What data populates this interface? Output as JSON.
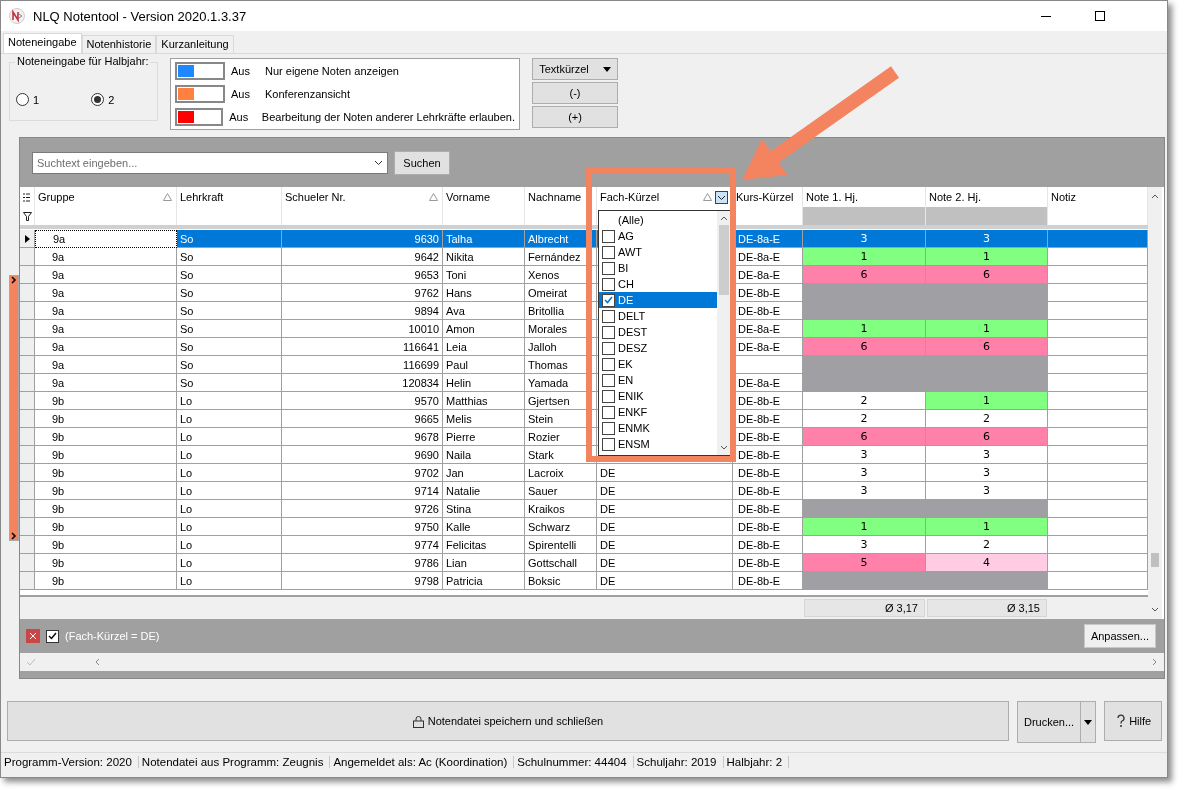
{
  "window": {
    "title": "NLQ Notentool - Version 2020.1.3.37"
  },
  "tabs": [
    {
      "label": "Noteneingabe",
      "selected": true
    },
    {
      "label": "Notenhistorie",
      "selected": false
    },
    {
      "label": "Kurzanleitung",
      "selected": false
    }
  ],
  "halbjahr": {
    "legend": "Noteneingabe für Halbjahr:",
    "options": [
      {
        "label": "1",
        "selected": false
      },
      {
        "label": "2",
        "selected": true
      }
    ]
  },
  "toggles": [
    {
      "color": "#1e88ff",
      "on": false,
      "state": "Aus",
      "label": "Nur eigene Noten anzeigen"
    },
    {
      "color": "#ff8040",
      "on": false,
      "state": "Aus",
      "label": "Konferenzansicht"
    },
    {
      "color": "#ff0000",
      "on": false,
      "state": "Aus",
      "label": "Bearbeitung der Noten anderer Lehrkräfte erlauben."
    }
  ],
  "toolbar_buttons": [
    {
      "label": "Textkürzel",
      "kind": "dropdown"
    },
    {
      "label": "(-)",
      "kind": "plain"
    },
    {
      "label": "(+)",
      "kind": "plain"
    }
  ],
  "search": {
    "placeholder": "Suchtext eingeben...",
    "button": "Suchen"
  },
  "table": {
    "columns": [
      {
        "label": "Gruppe",
        "kind": "text",
        "sorted": true
      },
      {
        "label": "Lehrkraft",
        "kind": "text",
        "sorted": false
      },
      {
        "label": "Schueler Nr.",
        "kind": "number",
        "sorted": true
      },
      {
        "label": "Vorname",
        "kind": "text",
        "sorted": false
      },
      {
        "label": "Nachname",
        "kind": "text",
        "sorted": false
      },
      {
        "label": "Fach-Kürzel",
        "kind": "filtered",
        "sorted": true
      },
      {
        "label": "Kurs-Kürzel",
        "kind": "text",
        "sorted": false
      },
      {
        "label": "Note 1. Hj.",
        "kind": "grade",
        "sorted": false
      },
      {
        "label": "Note 2. Hj.",
        "kind": "grade",
        "sorted": false
      },
      {
        "label": "Notiz",
        "kind": "text",
        "sorted": false
      }
    ],
    "rows": [
      {
        "selected": true,
        "gruppe": "9a",
        "lehrkraft": "So",
        "nr": "9630",
        "vorname": "Talha",
        "nachname": "Albrecht",
        "kurs": "DE-8a-E",
        "n1": {
          "text": "3"
        },
        "n2": {
          "text": "3"
        }
      },
      {
        "selected": false,
        "gruppe": "9a",
        "lehrkraft": "So",
        "nr": "9642",
        "vorname": "Nikita",
        "nachname": "Fernández",
        "kurs": "DE-8a-E",
        "n1": {
          "text": "1",
          "color": "#80ff80"
        },
        "n2": {
          "text": "1",
          "color": "#80ff80"
        }
      },
      {
        "selected": false,
        "gruppe": "9a",
        "lehrkraft": "So",
        "nr": "9653",
        "vorname": "Toni",
        "nachname": "Xenos",
        "kurs": "DE-8a-E",
        "n1": {
          "text": "6",
          "color": "#ff80a8"
        },
        "n2": {
          "text": "6",
          "color": "#ff80a8"
        }
      },
      {
        "selected": false,
        "gruppe": "9a",
        "lehrkraft": "So",
        "nr": "9762",
        "vorname": "Hans",
        "nachname": "Omeirat",
        "kurs": "DE-8b-E",
        "n1": {
          "color": "#a0a0a4"
        },
        "n2": {
          "color": "#a0a0a4"
        }
      },
      {
        "selected": false,
        "gruppe": "9a",
        "lehrkraft": "So",
        "nr": "9894",
        "vorname": "Ava",
        "nachname": "Britollia",
        "kurs": "DE-8b-E",
        "n1": {
          "color": "#a0a0a4"
        },
        "n2": {
          "color": "#a0a0a4"
        }
      },
      {
        "selected": false,
        "gruppe": "9a",
        "lehrkraft": "So",
        "nr": "10010",
        "vorname": "Amon",
        "nachname": "Morales",
        "kurs": "DE-8a-E",
        "n1": {
          "text": "1",
          "color": "#80ff80"
        },
        "n2": {
          "text": "1",
          "color": "#80ff80"
        }
      },
      {
        "selected": false,
        "gruppe": "9a",
        "lehrkraft": "So",
        "nr": "116641",
        "vorname": "Leia",
        "nachname": "Jalloh",
        "kurs": "DE-8a-E",
        "n1": {
          "text": "6",
          "color": "#ff80a8"
        },
        "n2": {
          "text": "6",
          "color": "#ff80a8"
        }
      },
      {
        "selected": false,
        "gruppe": "9a",
        "lehrkraft": "So",
        "nr": "116699",
        "vorname": "Paul",
        "nachname": "Thomas",
        "n1": {
          "color": "#a0a0a4"
        },
        "n2": {
          "color": "#a0a0a4"
        }
      },
      {
        "selected": false,
        "gruppe": "9a",
        "lehrkraft": "So",
        "nr": "120834",
        "vorname": "Helin",
        "nachname": "Yamada",
        "kurs": "DE-8a-E",
        "n1": {
          "color": "#a0a0a4"
        },
        "n2": {
          "color": "#a0a0a4"
        }
      },
      {
        "selected": false,
        "gruppe": "9b",
        "lehrkraft": "Lo",
        "nr": "9570",
        "vorname": "Matthias",
        "nachname": "Gjertsen",
        "kurs": "DE-8b-E",
        "n1": {
          "text": "2",
          "color": "#ffffff"
        },
        "n2": {
          "text": "1",
          "color": "#80ff80"
        }
      },
      {
        "selected": false,
        "gruppe": "9b",
        "lehrkraft": "Lo",
        "nr": "9665",
        "vorname": "Melis",
        "nachname": "Stein",
        "kurs": "DE-8b-E",
        "n1": {
          "text": "2",
          "color": "#ffffff"
        },
        "n2": {
          "text": "2",
          "color": "#ffffff"
        }
      },
      {
        "selected": false,
        "gruppe": "9b",
        "lehrkraft": "Lo",
        "nr": "9678",
        "vorname": "Pierre",
        "nachname": "Rozier",
        "kurs": "DE-8b-E",
        "n1": {
          "text": "6",
          "color": "#ff80a8"
        },
        "n2": {
          "text": "6",
          "color": "#ff80a8"
        }
      },
      {
        "selected": false,
        "gruppe": "9b",
        "lehrkraft": "Lo",
        "nr": "9690",
        "vorname": "Naila",
        "nachname": "Stark",
        "kurs": "DE-8b-E",
        "n1": {
          "text": "3",
          "color": "#ffffff"
        },
        "n2": {
          "text": "3",
          "color": "#ffffff"
        }
      },
      {
        "selected": false,
        "gruppe": "9b",
        "lehrkraft": "Lo",
        "nr": "9702",
        "vorname": "Jan",
        "nachname": "Lacroix",
        "fach": "DE",
        "kurs": "DE-8b-E",
        "n1": {
          "text": "3",
          "color": "#ffffff"
        },
        "n2": {
          "text": "3",
          "color": "#ffffff"
        }
      },
      {
        "selected": false,
        "gruppe": "9b",
        "lehrkraft": "Lo",
        "nr": "9714",
        "vorname": "Natalie",
        "nachname": "Sauer",
        "fach": "DE",
        "kurs": "DE-8b-E",
        "n1": {
          "text": "3",
          "color": "#ffffff"
        },
        "n2": {
          "text": "3",
          "color": "#ffffff"
        }
      },
      {
        "selected": false,
        "gruppe": "9b",
        "lehrkraft": "Lo",
        "nr": "9726",
        "vorname": "Stina",
        "nachname": "Kraikos",
        "fach": "DE",
        "kurs": "DE-8b-E",
        "n1": {
          "color": "#a0a0a4"
        },
        "n2": {
          "color": "#a0a0a4"
        }
      },
      {
        "selected": false,
        "gruppe": "9b",
        "lehrkraft": "Lo",
        "nr": "9750",
        "vorname": "Kalle",
        "nachname": "Schwarz",
        "fach": "DE",
        "kurs": "DE-8b-E",
        "n1": {
          "text": "1",
          "color": "#80ff80"
        },
        "n2": {
          "text": "1",
          "color": "#80ff80"
        }
      },
      {
        "selected": false,
        "gruppe": "9b",
        "lehrkraft": "Lo",
        "nr": "9774",
        "vorname": "Felicitas",
        "nachname": "Spirentelli",
        "fach": "DE",
        "kurs": "DE-8b-E",
        "n1": {
          "text": "3",
          "color": "#ffffff"
        },
        "n2": {
          "text": "2",
          "color": "#ffffff"
        }
      },
      {
        "selected": false,
        "gruppe": "9b",
        "lehrkraft": "Lo",
        "nr": "9786",
        "vorname": "Lian",
        "nachname": "Gottschall",
        "fach": "DE",
        "kurs": "DE-8b-E",
        "n1": {
          "text": "5",
          "color": "#ff80a8"
        },
        "n2": {
          "text": "4",
          "color": "#ffcce4"
        }
      },
      {
        "selected": false,
        "gruppe": "9b",
        "lehrkraft": "Lo",
        "nr": "9798",
        "vorname": "Patricia",
        "nachname": "Boksic",
        "fach": "DE",
        "kurs": "DE-8b-E",
        "n1": {
          "color": "#a0a0a4"
        },
        "n2": {
          "color": "#a0a0a4"
        }
      }
    ],
    "summary": {
      "n1": "Ø 3,17",
      "n2": "Ø 3,15"
    }
  },
  "filter_dropdown": {
    "items": [
      {
        "kind": "all",
        "label": "(Alle)",
        "selected": false
      },
      {
        "kind": "value",
        "label": "AG",
        "checked": false,
        "selected": false
      },
      {
        "kind": "value",
        "label": "AWT",
        "checked": false,
        "selected": false
      },
      {
        "kind": "value",
        "label": "BI",
        "checked": false,
        "selected": false
      },
      {
        "kind": "value",
        "label": "CH",
        "checked": false,
        "selected": false
      },
      {
        "kind": "value",
        "label": "DE",
        "checked": true,
        "selected": true
      },
      {
        "kind": "value",
        "label": "DELT",
        "checked": false,
        "selected": false
      },
      {
        "kind": "value",
        "label": "DEST",
        "checked": false,
        "selected": false
      },
      {
        "kind": "value",
        "label": "DESZ",
        "checked": false,
        "selected": false
      },
      {
        "kind": "value",
        "label": "EK",
        "checked": false,
        "selected": false
      },
      {
        "kind": "value",
        "label": "EN",
        "checked": false,
        "selected": false
      },
      {
        "kind": "value",
        "label": "ENIK",
        "checked": false,
        "selected": false
      },
      {
        "kind": "value",
        "label": "ENKF",
        "checked": false,
        "selected": false
      },
      {
        "kind": "value",
        "label": "ENMK",
        "checked": false,
        "selected": false
      },
      {
        "kind": "value",
        "label": "ENSM",
        "checked": false,
        "selected": false
      }
    ]
  },
  "filter_bar": {
    "checked": true,
    "expression": "(Fach-Kürzel = DE)",
    "button": "Anpassen..."
  },
  "actions": {
    "save": "Notendatei speichern und schließen",
    "print": "Drucken...",
    "help": "Hilfe"
  },
  "status_bar": [
    "Programm-Version: 2020",
    "Notendatei aus Programm: Zeugnis",
    "Angemeldet als: Ac (Koordination)",
    "Schulnummer: 44404",
    "Schuljahr: 2019",
    "Halbjahr: 2"
  ]
}
